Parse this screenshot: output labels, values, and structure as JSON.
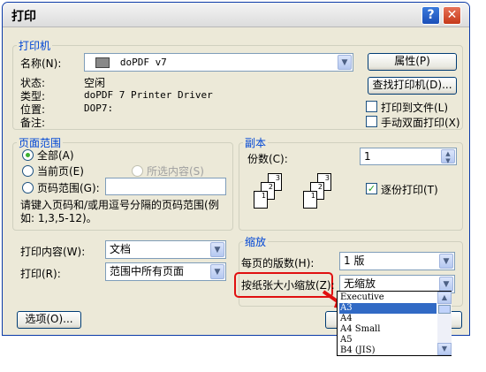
{
  "window": {
    "title": "打印",
    "help_glyph": "?",
    "close_glyph": "✕"
  },
  "printer": {
    "legend": "打印机",
    "name_label": "名称(N):",
    "name_value": "doPDF v7",
    "properties_button": "属性(P)",
    "find_printer_button": "查找打印机(D)...",
    "status_label": "状态:",
    "status_value": "空闲",
    "type_label": "类型:",
    "type_value": "doPDF 7 Printer Driver",
    "location_label": "位置:",
    "location_value": "DOP7:",
    "comment_label": "备注:",
    "print_to_file_label": "打印到文件(L)",
    "manual_duplex_label": "手动双面打印(X)"
  },
  "page_range": {
    "legend": "页面范围",
    "all_label": "全部(A)",
    "current_label": "当前页(E)",
    "selection_label": "所选内容(S)",
    "pages_label": "页码范围(G):",
    "pages_value": "",
    "hint": "请键入页码和/或用逗号分隔的页码范围(例如: 1,3,5-12)。"
  },
  "copies": {
    "legend": "副本",
    "count_label": "份数(C):",
    "count_value": "1",
    "collate_label": "逐份打印(T)",
    "collate_checked": true,
    "stack1": [
      "1",
      "2",
      "3"
    ],
    "stack2": [
      "1",
      "2",
      "3"
    ]
  },
  "print_what": {
    "label": "打印内容(W):",
    "value": "文档"
  },
  "print": {
    "label": "打印(R):",
    "value": "范围中所有页面"
  },
  "zoom": {
    "legend": "缩放",
    "pages_per_sheet_label": "每页的版数(H):",
    "pages_per_sheet_value": "1 版",
    "scale_label": "按纸张大小缩放(Z):",
    "scale_value": "无缩放",
    "options": [
      "Executive",
      "A3",
      "A4",
      "A4 Small",
      "A5",
      "B4 (JIS)"
    ],
    "selected_index": 1
  },
  "footer": {
    "options_button": "选项(O)..."
  },
  "colors": {
    "accent": "#0046d5",
    "highlight": "#e01010",
    "selection": "#316ac5"
  }
}
